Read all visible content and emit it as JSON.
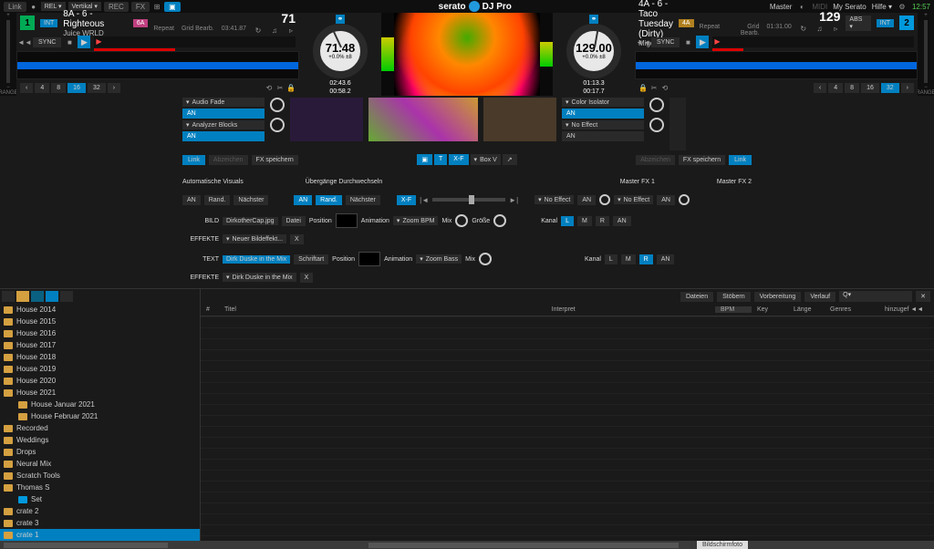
{
  "topbar": {
    "link": "Link",
    "rel": "REL ▾",
    "vertical": "Vertikal ▾",
    "rec": "REC",
    "fx": "FX",
    "title_brand": "serato",
    "title_product": "DJ Pro",
    "master": "Master",
    "midi": "MIDI",
    "myserato": "My Serato",
    "hilfe": "Hilfe ▾",
    "clock": "12:57"
  },
  "deck1": {
    "num": "1",
    "int": "INT",
    "key": "8A - 6 - Righteous",
    "artist": "Juice WRLD",
    "ext_key": "6A",
    "bpm": "71",
    "time": "03:41.87",
    "repeat": "Repeat",
    "grid": "Grid Bearb.",
    "sync": "SYNC",
    "jog_bpm": "71.48",
    "jog_offset": "+0.0%",
    "jog_pm8": "±8",
    "jog_t1": "02:43.6",
    "jog_t2": "00:58.2",
    "range": "RANGE",
    "beats": [
      "‹",
      "4",
      "8",
      "16",
      "32",
      "›"
    ],
    "active_beat": "16"
  },
  "deck2": {
    "num": "2",
    "int": "INT",
    "abs": "ABS ▾",
    "key": "4A - 6 - Taco Tuesday (Dirty)",
    "artist": "Migos",
    "ext_key": "4A",
    "bpm": "129",
    "time": "01:31.00",
    "repeat": "Repeat",
    "grid": "Grid Bearb.",
    "sync": "SYNC",
    "jog_bpm": "129.00",
    "jog_offset": "+0.0%",
    "jog_pm8": "±8",
    "jog_t1": "01:13.3",
    "jog_t2": "00:17.7",
    "range": "RANGE",
    "beats": [
      "‹",
      "4",
      "8",
      "16",
      "32",
      "›"
    ],
    "active_beat": "32"
  },
  "fx": {
    "audio_fade": "Audio Fade",
    "analyzer_blocks": "Analyzer Blocks",
    "an": "AN",
    "color_isolator": "Color Isolator",
    "no_effect": "No Effect",
    "link": "Link",
    "abzeichen": "Abzeichen",
    "fx_speichern": "FX speichern",
    "box_v": "Box V",
    "xf": "X-F",
    "auto_visuals": "Automatische Visuals",
    "rand": "Rand.",
    "nachster": "Nächster",
    "ubergange": "Übergänge Durchwechseln",
    "master_fx1": "Master FX 1",
    "master_fx2": "Master FX 2",
    "bild": "BILD",
    "effekte": "EFFEKTE",
    "text_label": "TEXT",
    "dirk_cap": "DirkotherCap.jpg",
    "neuer_bild": "Neuer Bildeffekt...",
    "datei": "Datei",
    "position": "Position",
    "animation": "Animation",
    "zoom_bpm": "Zoom BPM",
    "zoom_bass": "Zoom Bass",
    "mix": "Mix",
    "grosse": "Größe",
    "kanal": "Kanal",
    "l": "L",
    "m": "M",
    "r": "R",
    "dirk_mix": "Dirk Duske in the Mix",
    "dirk_mix2": "Dirk Duske in the Mix",
    "schriftart": "Schriftart"
  },
  "browser": {
    "tabs": [
      "Dateien",
      "Stöbern",
      "Vorbereitung",
      "Verlauf"
    ],
    "search_placeholder": "Q▾",
    "hinzu": "hinzugef ◄◄",
    "cols": {
      "num": "#",
      "titel": "Titel",
      "interpret": "Interpret",
      "bpm": "BPM",
      "key": "Key",
      "lange": "Länge",
      "genres": "Genres"
    }
  },
  "crates": [
    {
      "name": "House 2014",
      "icon": "folder"
    },
    {
      "name": "House 2015",
      "icon": "folder"
    },
    {
      "name": "House 2016",
      "icon": "folder"
    },
    {
      "name": "House 2017",
      "icon": "folder"
    },
    {
      "name": "House 2018",
      "icon": "folder"
    },
    {
      "name": "House 2019",
      "icon": "folder"
    },
    {
      "name": "House 2020",
      "icon": "folder"
    },
    {
      "name": "House 2021",
      "icon": "folder"
    },
    {
      "name": "House Januar 2021",
      "icon": "folder",
      "sub": true
    },
    {
      "name": "House Februar 2021",
      "icon": "folder",
      "sub": true
    },
    {
      "name": "Recorded",
      "icon": "folder-y"
    },
    {
      "name": "Weddings",
      "icon": "folder-y"
    },
    {
      "name": "Drops",
      "icon": "folder-y"
    },
    {
      "name": "Neural Mix",
      "icon": "folder-y"
    },
    {
      "name": "Scratch Tools",
      "icon": "folder-y"
    },
    {
      "name": "Thomas S",
      "icon": "folder-y"
    },
    {
      "name": "Set",
      "icon": "blue",
      "sub": true
    },
    {
      "name": "crate 2",
      "icon": "folder-y"
    },
    {
      "name": "crate 3",
      "icon": "folder-y"
    },
    {
      "name": "crate 1",
      "icon": "folder-y",
      "selected": true
    }
  ],
  "screenshot_label": "Bildschirmfoto"
}
